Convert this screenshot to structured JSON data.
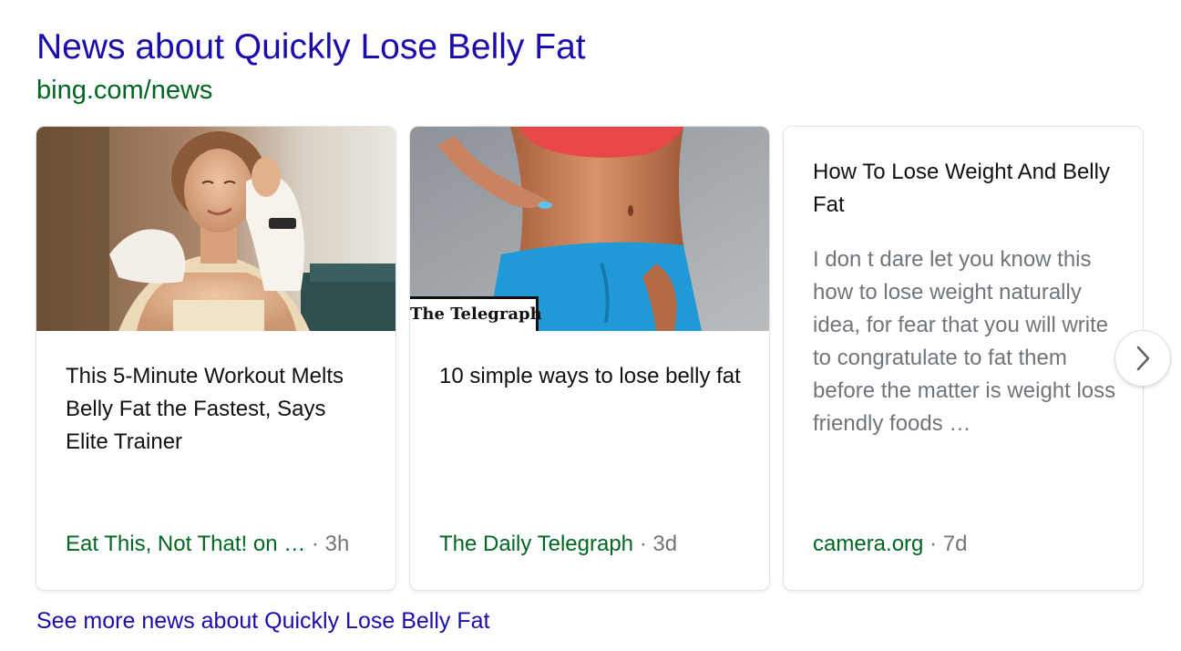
{
  "header": {
    "title": "News about Quickly Lose Belly Fat",
    "url": "bing.com/news"
  },
  "cards": [
    {
      "headline": "This 5-Minute Workout Melts Belly Fat the Fastest, Says Elite Trainer",
      "source": "Eat This, Not That! on …",
      "separator": "·",
      "age": "3h",
      "image": "woman-wiping-face-with-towel-photo"
    },
    {
      "headline": "10 simple ways to lose belly fat",
      "source": "The Daily Telegraph",
      "separator": "·",
      "age": "3d",
      "image": "woman-pinching-belly-photo",
      "badge": "The Telegraph"
    },
    {
      "headline": "How To Lose Weight And Belly Fat",
      "snippet": "I don t dare let you know this how to lose weight naturally idea, for fear that you will write to congratulate to fat them before the matter is weight loss friendly foods …",
      "source": "camera.org",
      "separator": "·",
      "age": "7d"
    }
  ],
  "carousel": {
    "next_icon": "chevron-right-icon"
  },
  "footer": {
    "see_more": "See more news about Quickly Lose Belly Fat"
  },
  "colors": {
    "link_blue": "#1a0dab",
    "url_green": "#006621",
    "meta_gray": "#70757a",
    "text_dark": "#111111"
  }
}
